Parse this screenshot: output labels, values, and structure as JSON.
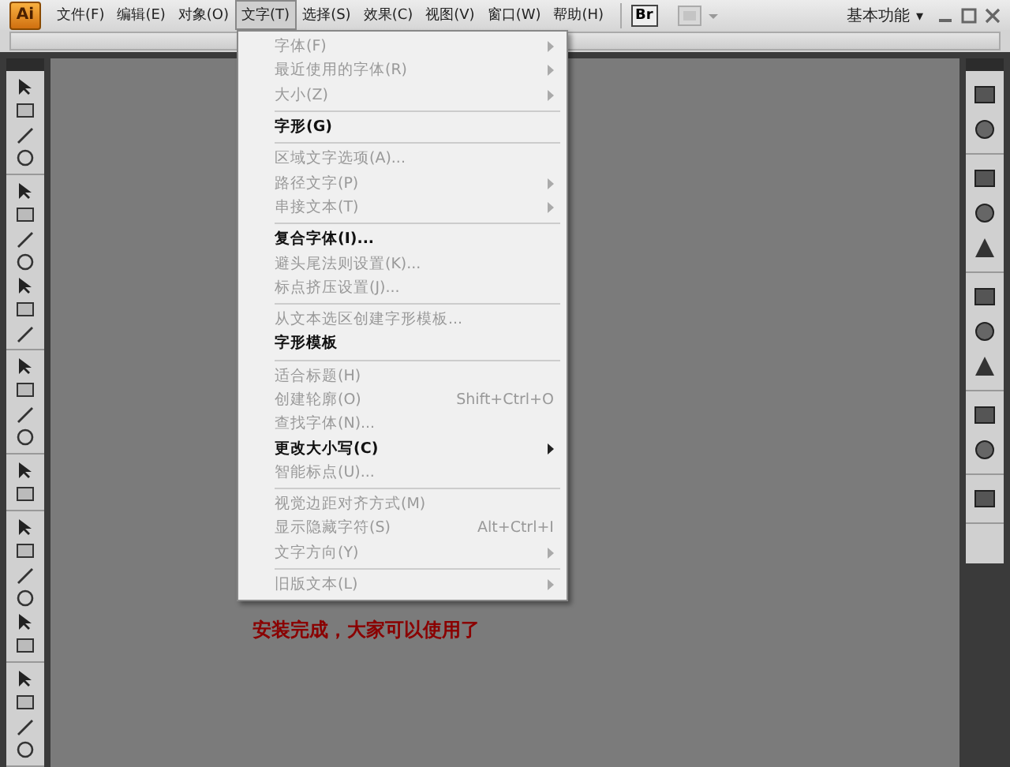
{
  "menu_bar": {
    "items": [
      {
        "label": "文件(F)",
        "selected": false
      },
      {
        "label": "编辑(E)",
        "selected": false
      },
      {
        "label": "对象(O)",
        "selected": false
      },
      {
        "label": "文字(T)",
        "selected": true
      },
      {
        "label": "选择(S)",
        "selected": false
      },
      {
        "label": "效果(C)",
        "selected": false
      },
      {
        "label": "视图(V)",
        "selected": false
      },
      {
        "label": "窗口(W)",
        "selected": false
      },
      {
        "label": "帮助(H)",
        "selected": false
      }
    ],
    "logo_text": "Ai",
    "bridge_label": "Br",
    "workspace_caret": "▾",
    "workspace": "基本功能"
  },
  "type_menu": {
    "items": [
      {
        "kind": "item",
        "label": "字体(F)",
        "disabled": true,
        "submenu": true
      },
      {
        "kind": "item",
        "label": "最近使用的字体(R)",
        "disabled": true,
        "submenu": true
      },
      {
        "kind": "item",
        "label": "大小(Z)",
        "disabled": true,
        "submenu": true
      },
      {
        "kind": "separator"
      },
      {
        "kind": "item",
        "label": "字形(G)",
        "disabled": false,
        "submenu": false
      },
      {
        "kind": "separator"
      },
      {
        "kind": "item",
        "label": "区域文字选项(A)...",
        "disabled": true,
        "submenu": false
      },
      {
        "kind": "item",
        "label": "路径文字(P)",
        "disabled": true,
        "submenu": true
      },
      {
        "kind": "item",
        "label": "串接文本(T)",
        "disabled": true,
        "submenu": true
      },
      {
        "kind": "separator"
      },
      {
        "kind": "item",
        "label": "复合字体(I)...",
        "disabled": false,
        "submenu": false
      },
      {
        "kind": "item",
        "label": "避头尾法则设置(K)...",
        "disabled": true,
        "submenu": false
      },
      {
        "kind": "item",
        "label": "标点挤压设置(J)...",
        "disabled": true,
        "submenu": false
      },
      {
        "kind": "separator"
      },
      {
        "kind": "item",
        "label": "从文本选区创建字形模板...",
        "disabled": true,
        "submenu": false
      },
      {
        "kind": "item",
        "label": "字形模板",
        "disabled": false,
        "submenu": false
      },
      {
        "kind": "separator"
      },
      {
        "kind": "item",
        "label": "适合标题(H)",
        "disabled": true,
        "submenu": false
      },
      {
        "kind": "item",
        "label": "创建轮廓(O)",
        "disabled": true,
        "submenu": false,
        "shortcut": "Shift+Ctrl+O"
      },
      {
        "kind": "item",
        "label": "查找字体(N)...",
        "disabled": true,
        "submenu": false
      },
      {
        "kind": "item",
        "label": "更改大小写(C)",
        "disabled": false,
        "submenu": true
      },
      {
        "kind": "item",
        "label": "智能标点(U)...",
        "disabled": true,
        "submenu": false
      },
      {
        "kind": "separator"
      },
      {
        "kind": "item",
        "label": "视觉边距对齐方式(M)",
        "disabled": true,
        "submenu": false
      },
      {
        "kind": "item",
        "label": "显示隐藏字符(S)",
        "disabled": true,
        "submenu": false,
        "shortcut": "Alt+Ctrl+I"
      },
      {
        "kind": "item",
        "label": "文字方向(Y)",
        "disabled": true,
        "submenu": true
      },
      {
        "kind": "separator"
      },
      {
        "kind": "item",
        "label": "旧版文本(L)",
        "disabled": true,
        "submenu": true
      }
    ]
  },
  "canvas": {
    "message": "安装完成，大家可以使用了"
  }
}
